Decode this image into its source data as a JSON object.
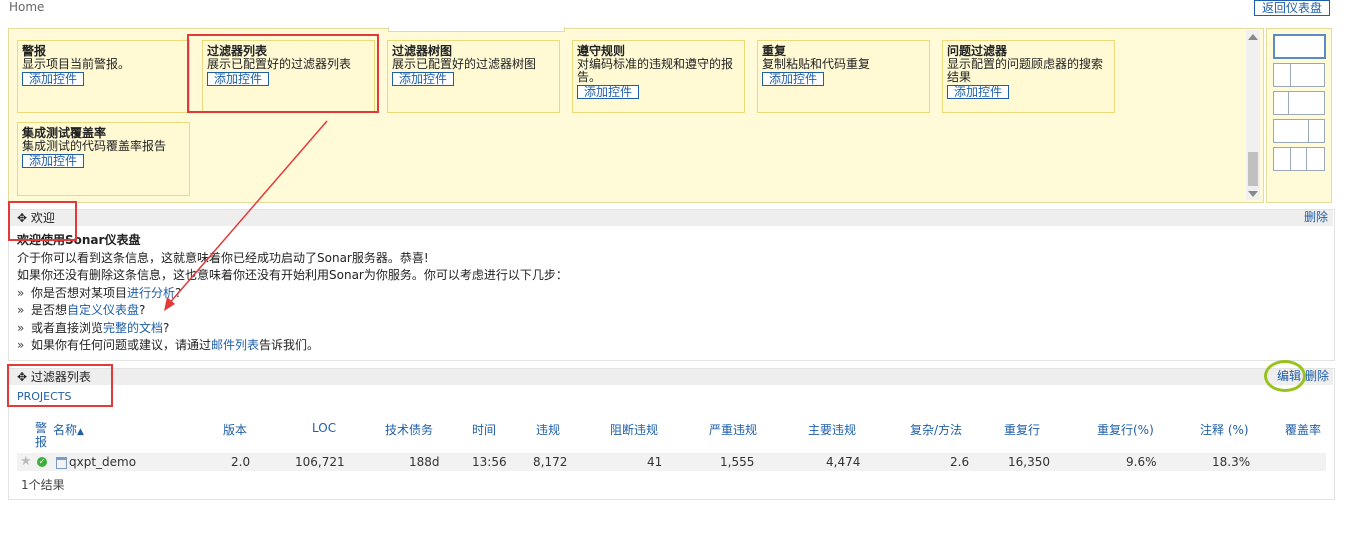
{
  "breadcrumb": "Home",
  "back_button": "返回仪表盘",
  "palette": {
    "add_label": "添加控件",
    "widgets": [
      {
        "title": "警报",
        "desc": "显示项目当前警报。"
      },
      {
        "title": "过滤器列表",
        "desc": "展示已配置好的过滤器列表"
      },
      {
        "title": "过滤器树图",
        "desc": "展示已配置好的过滤器树图"
      },
      {
        "title": "遵守规则",
        "desc": "对编码标准的违规和遵守的报告。"
      },
      {
        "title": "重复",
        "desc": "复制粘贴和代码重复"
      },
      {
        "title": "问题过滤器",
        "desc": "显示配置的问题顾虑器的搜索结果"
      },
      {
        "title": "集成测试覆盖率",
        "desc": "集成测试的代码覆盖率报告"
      }
    ]
  },
  "welcome": {
    "title": "欢迎",
    "delete": "删除",
    "heading": "欢迎使用Sonar仪表盘",
    "line1": "介于你可以看到这条信息，这就意味着你已经成功启动了Sonar服务器。恭喜!",
    "line2": "如果你还没有删除这条信息，这也意味着你还没有开始利用Sonar为你服务。你可以考虑进行以下几步：",
    "bullet_mark": "»",
    "b1_pre": "你是否想对某项目",
    "b1_link": "进行分析",
    "b1_post": "?",
    "b2_pre": "是否想",
    "b2_link": "自定义仪表盘",
    "b2_post": "?",
    "b3_pre": "或者直接浏览",
    "b3_link": "完整的文档",
    "b3_post": "?",
    "b4_pre": "如果你有任何问题或建议，请通过",
    "b4_link": "邮件列表",
    "b4_post": "告诉我们。"
  },
  "filter": {
    "title": "过滤器列表",
    "edit": "编辑",
    "delete": "删除",
    "projects": "PROJECTS",
    "columns": {
      "alert": "警报",
      "name": "名称",
      "sort_arrow": "▲",
      "version": "版本",
      "loc": "LOC",
      "debt": "技术债务",
      "time": "时间",
      "violations": "违规",
      "blocker": "阻断违规",
      "critical": "严重违规",
      "major": "主要违规",
      "complexity": "复杂/方法",
      "dup_lines": "重复行",
      "dup_pct": "重复行(%)",
      "comments": "注释 (%)",
      "coverage": "覆盖率"
    },
    "row": {
      "name": "qxpt_demo",
      "version": "2.0",
      "loc": "106,721",
      "debt": "188d",
      "time": "13:56",
      "violations": "8,172",
      "blocker": "41",
      "critical": "1,555",
      "major": "4,474",
      "complexity": "2.6",
      "dup_lines": "16,350",
      "dup_pct": "9.6%",
      "comments": "18.3%"
    },
    "result_count": "1个结果"
  },
  "icons": {
    "star": "star-icon",
    "status": "status-ok-icon",
    "project": "project-icon",
    "expand": "expand-icon"
  },
  "colors": {
    "link": "#1f5fa8",
    "annotation_red": "#e23a3a",
    "annotation_green": "#9ac21e",
    "palette_bg": "#fffbd9",
    "status_ok": "#3cae3c"
  }
}
